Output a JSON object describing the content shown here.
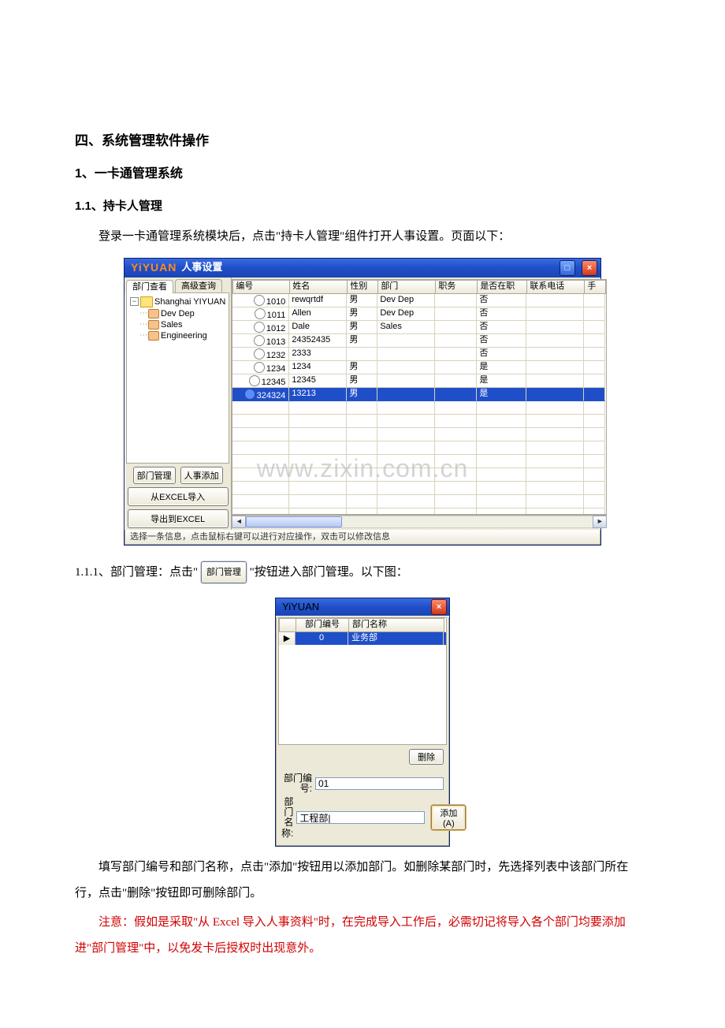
{
  "doc": {
    "h1": "四、系统管理软件操作",
    "h2": "1、一卡通管理系统",
    "h3": "1.1、持卡人管理",
    "p1": "登录一卡通管理系统模块后，点击\"持卡人管理\"组件打开人事设置。页面以下：",
    "sec111_pre": "1.1.1、部门管理：点击\"",
    "sec111_btn": "部门管理",
    "sec111_post": "\"按钮进入部门管理。以下图：",
    "p2": "填写部门编号和部门名称，点击\"添加\"按钮用以添加部门。如删除某部门时，先选择列表中该部门所在行，点击\"删除\"按钮即可删除部门。",
    "note": "注意：假如是采取\"从 Excel 导入人事资料\"时，在完成导入工作后，必需切记将导入各个部门均要添加进\"部门管理\"中，以免发卡后授权时出现意外。"
  },
  "watermark": "www.zixin.com.cn",
  "win1": {
    "logo": "YiYUAN",
    "title": "人事设置",
    "btn_max": "□",
    "btn_close": "×",
    "tabs": {
      "t1": "部门查看",
      "t2": "高级查询"
    },
    "tree": {
      "root": "Shanghai YIYUAN",
      "children": [
        "Dev Dep",
        "Sales",
        "Engineering"
      ]
    },
    "buttons": {
      "dept_mgmt": "部门管理",
      "add_person": "人事添加",
      "import_excel": "从EXCEL导入",
      "export_excel": "导出到EXCEL"
    },
    "columns": [
      "编号",
      "姓名",
      "性别",
      "部门",
      "职务",
      "是否在职",
      "联系电话",
      "手"
    ],
    "rows": [
      {
        "id": "1010",
        "name": "rewqrtdf",
        "sex": "男",
        "dept": "Dev Dep",
        "duty": "",
        "on": "否",
        "tel": ""
      },
      {
        "id": "1011",
        "name": "Allen",
        "sex": "男",
        "dept": "Dev Dep",
        "duty": "",
        "on": "否",
        "tel": ""
      },
      {
        "id": "1012",
        "name": "Dale",
        "sex": "男",
        "dept": "Sales",
        "duty": "",
        "on": "否",
        "tel": ""
      },
      {
        "id": "1013",
        "name": "24352435",
        "sex": "男",
        "dept": "",
        "duty": "",
        "on": "否",
        "tel": ""
      },
      {
        "id": "1232",
        "name": "2333",
        "sex": "",
        "dept": "",
        "duty": "",
        "on": "否",
        "tel": ""
      },
      {
        "id": "1234",
        "name": "1234",
        "sex": "男",
        "dept": "",
        "duty": "",
        "on": "是",
        "tel": ""
      },
      {
        "id": "12345",
        "name": "12345",
        "sex": "男",
        "dept": "",
        "duty": "",
        "on": "是",
        "tel": ""
      },
      {
        "id": "324324",
        "name": "13213",
        "sex": "男",
        "dept": "",
        "duty": "",
        "on": "是",
        "tel": "",
        "selected": true
      }
    ],
    "status": "选择一条信息，点击鼠标右键可以进行对应操作，双击可以修改信息",
    "scroll_left": "◄",
    "scroll_right": "►"
  },
  "win2": {
    "logo": "YiYUAN",
    "btn_close": "×",
    "cols": {
      "ptr": "▶",
      "c0": "部门编号",
      "c1": "部门名称"
    },
    "row": {
      "id": "0",
      "name": "业务部"
    },
    "btn_delete": "删除",
    "lbl_id": "部门编号:",
    "lbl_name": "部门名称:",
    "val_id": "01",
    "val_name": "工程部|",
    "btn_add": "添加(A)"
  }
}
